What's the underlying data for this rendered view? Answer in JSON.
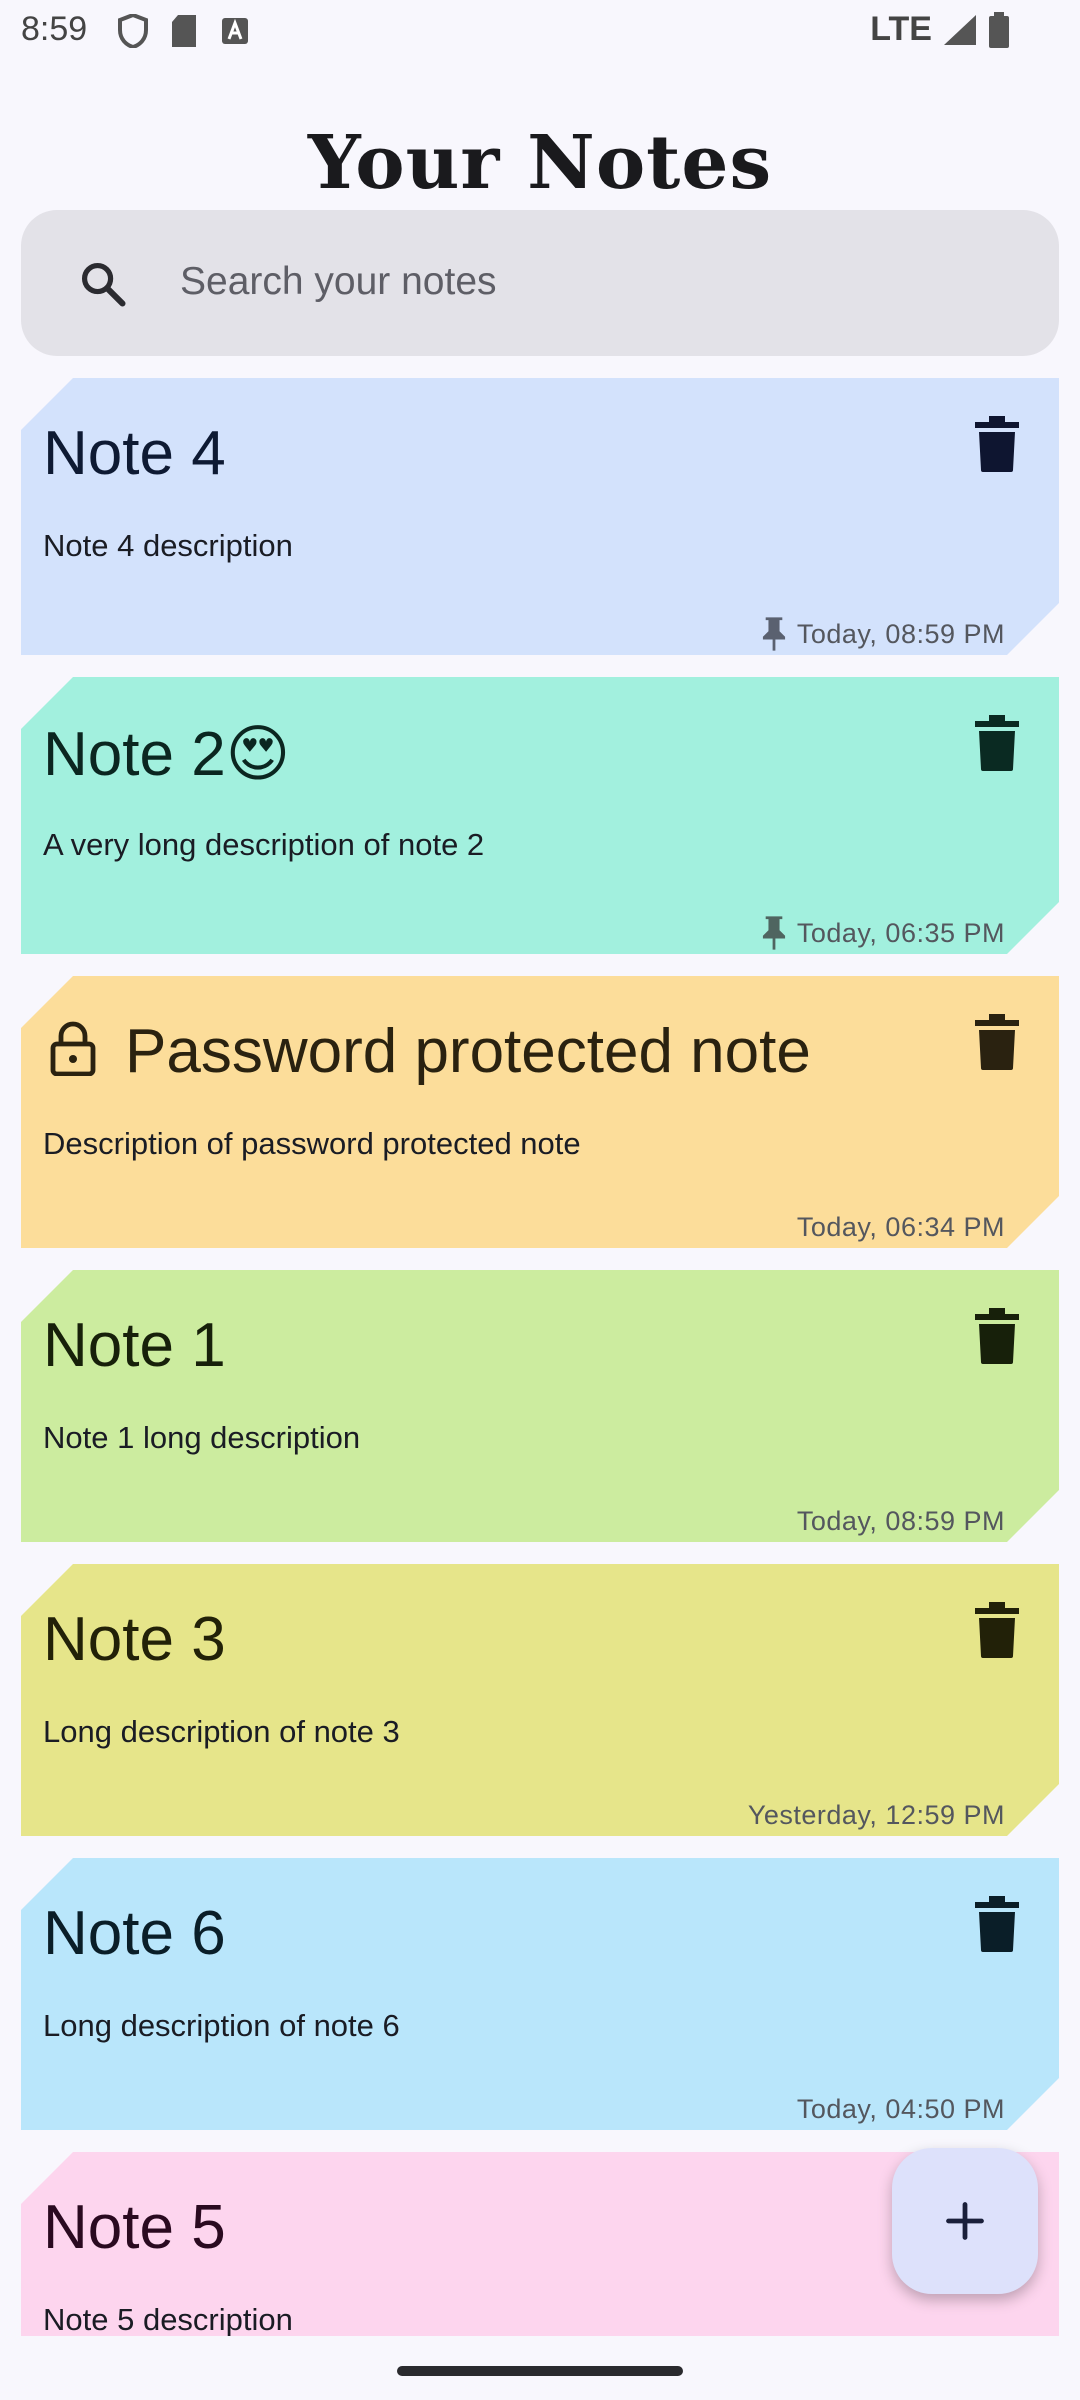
{
  "status_bar": {
    "time": "8:59",
    "network": "LTE"
  },
  "header": {
    "title": "Your Notes"
  },
  "search": {
    "placeholder": "Search your notes"
  },
  "notes": [
    {
      "title": "Note 4",
      "description": "Note 4 description",
      "date": "Today, 08:59 PM",
      "pinned": true,
      "locked": false,
      "color": "#D3E2FC"
    },
    {
      "title": "Note 2😍",
      "description": "A very long description of note 2",
      "date": "Today, 06:35 PM",
      "pinned": true,
      "locked": false,
      "color": "#A2F0DE"
    },
    {
      "title": "Password protected note",
      "description": "Description of password protected note",
      "date": "Today, 06:34 PM",
      "pinned": false,
      "locked": true,
      "color": "#FCDD9A"
    },
    {
      "title": "Note 1",
      "description": "Note 1 long description",
      "date": "Today, 08:59 PM",
      "pinned": false,
      "locked": false,
      "color": "#CCEC9F"
    },
    {
      "title": "Note 3",
      "description": "Long description of note 3",
      "date": "Yesterday, 12:59 PM",
      "pinned": false,
      "locked": false,
      "color": "#E6E58A"
    },
    {
      "title": "Note 6",
      "description": "Long description of note 6",
      "date": "Today, 04:50 PM",
      "pinned": false,
      "locked": false,
      "color": "#B9E6FB"
    },
    {
      "title": "Note 5",
      "description": "Note 5 description",
      "date": "",
      "pinned": false,
      "locked": false,
      "color": "#FDD5EE"
    }
  ],
  "icons": {
    "search": "search-icon",
    "delete": "trash-icon",
    "pin": "pin-icon",
    "lock": "lock-icon",
    "add": "plus-icon"
  }
}
